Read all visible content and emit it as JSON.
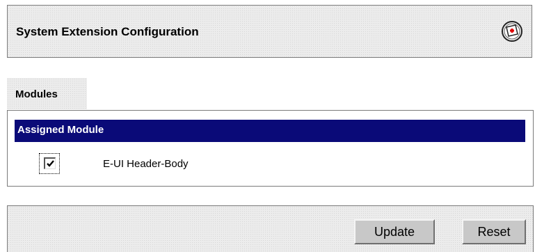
{
  "header": {
    "title": "System Extension Configuration",
    "help_icon": "help-icon"
  },
  "tab": {
    "label": "Modules"
  },
  "table": {
    "column_header": "Assigned Module",
    "header_color": "#0a0a78",
    "rows": [
      {
        "label": "E-UI Header-Body",
        "checked": true
      }
    ]
  },
  "buttons": {
    "update": "Update",
    "reset": "Reset"
  }
}
